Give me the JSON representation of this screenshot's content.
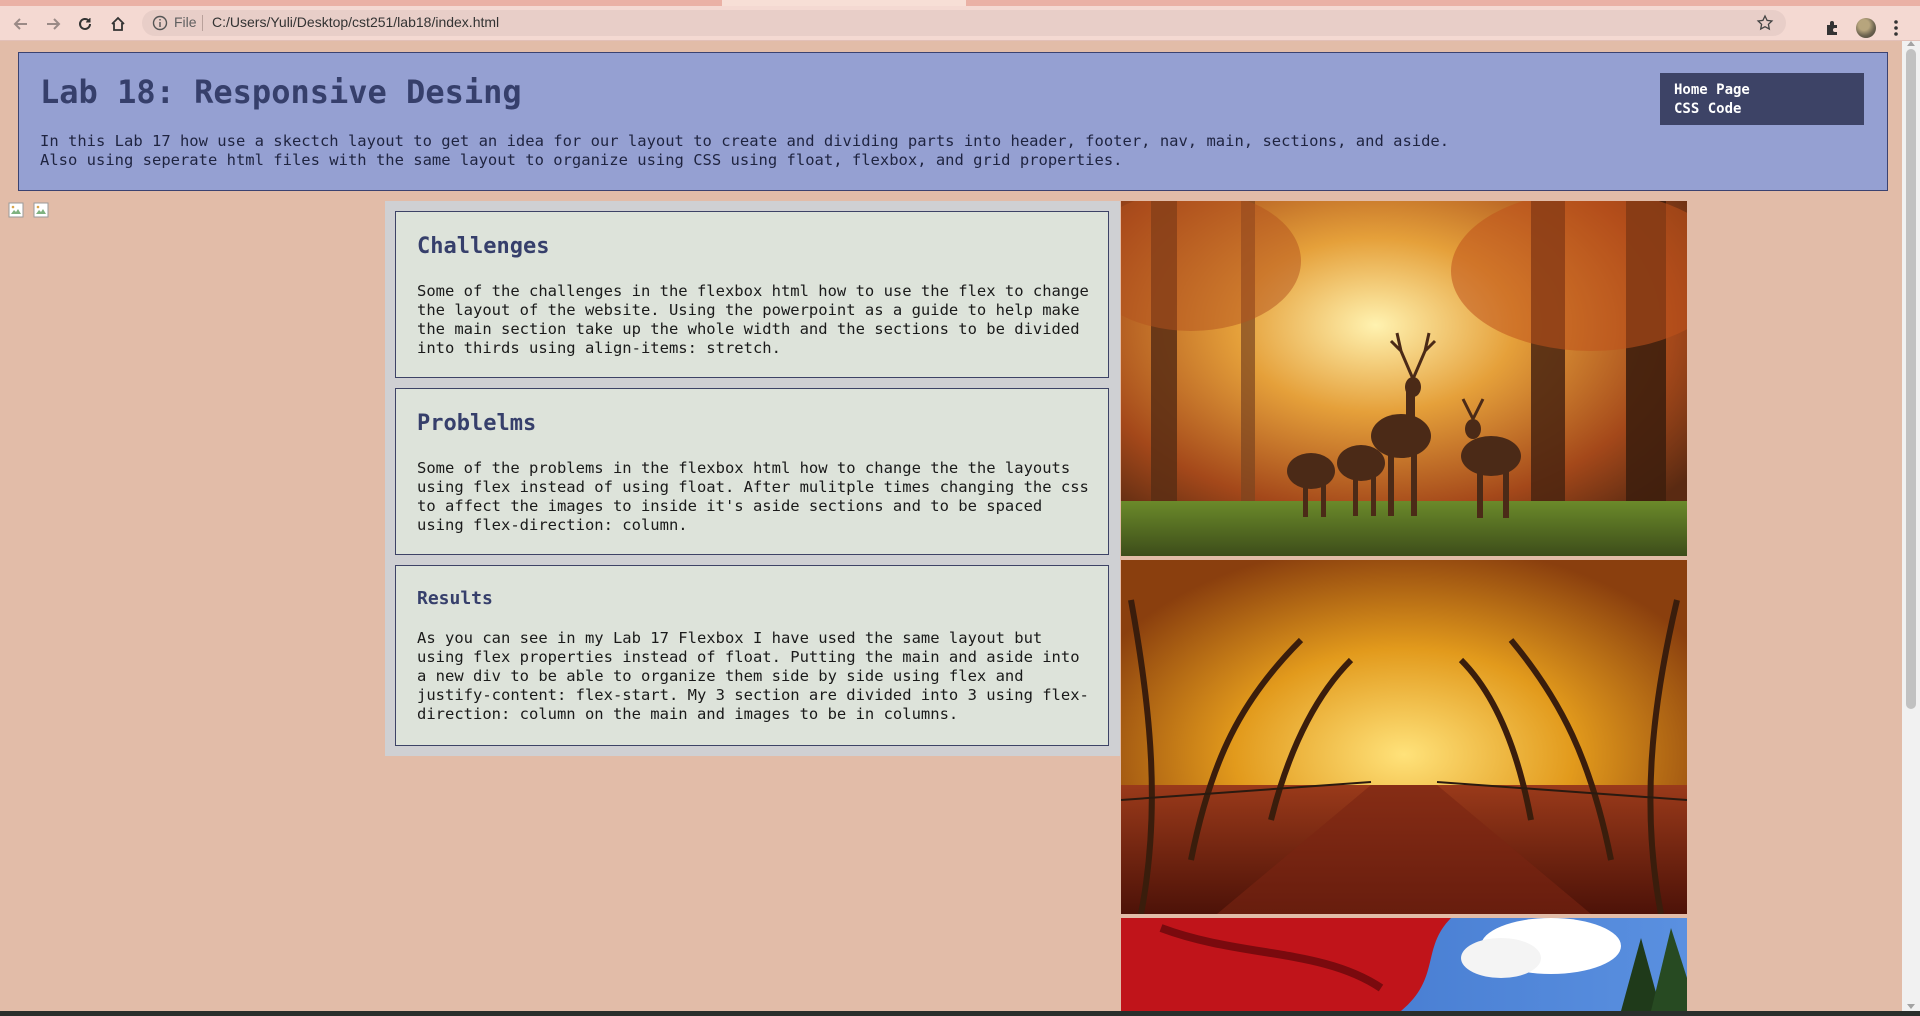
{
  "browser": {
    "scheme": "File",
    "url": "C:/Users/Yuli/Desktop/cst251/lab18/index.html"
  },
  "header": {
    "title": "Lab 18: Responsive Desing",
    "intro": "In this Lab 17 how use a skectch layout to get an idea for our layout to create and dividing parts into header, footer, nav, main, sections, and aside. Also using seperate html files with the same layout to organize using CSS using float, flexbox, and grid properties."
  },
  "nav": {
    "items": [
      {
        "label": "Home Page"
      },
      {
        "label": "CSS Code"
      }
    ]
  },
  "sections": [
    {
      "heading": "Challenges",
      "text": "Some of the challenges in the flexbox html how to use the flex to change the layout of the website. Using the powerpoint as a guide to help make the main section take up the whole width and the sections to be divided into thirds using align-items: stretch."
    },
    {
      "heading": "Problelms",
      "text": "Some of the problems in the flexbox html how to change the the layouts using flex instead of using float. After mulitple times changing the css to affect the images to inside it's aside sections and to be spaced using flex-direction: column."
    },
    {
      "heading": "Results",
      "text": "As you can see in my Lab 17 Flexbox I have used the same layout but using flex properties instead of float. Putting the main and aside into a new div to be able to organize them side by side using flex and justify-content: flex-start. My 3 section are divided into 3 using flex-direction: column on the main and images to be in columns."
    }
  ],
  "aside": {
    "images": [
      {
        "icon": "autumn-deer-forest-image"
      },
      {
        "icon": "autumn-park-path-image"
      },
      {
        "icon": "red-autumn-trees-sky-image"
      }
    ]
  },
  "colors": {
    "page_background": "#e2bca8",
    "header_background": "#95a0d2",
    "nav_background": "#3d4366",
    "card_background": "#dde3da",
    "heading_color": "#363f6b"
  }
}
